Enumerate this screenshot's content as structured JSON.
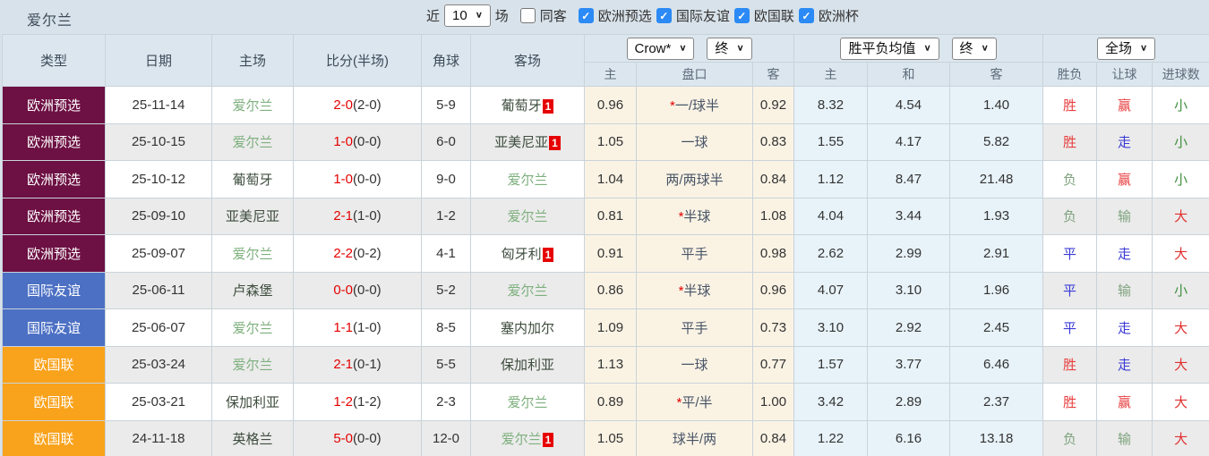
{
  "title": "爱尔兰",
  "icons": {
    "check": "✓",
    "chevron_down": "∨"
  },
  "toolbar": {
    "recent_label": "近",
    "recent_value": "10",
    "matches_label": "场",
    "same_away_label": "同客",
    "same_away_checked": false,
    "filters": [
      {
        "label": "欧洲预选",
        "checked": true
      },
      {
        "label": "国际友谊",
        "checked": true
      },
      {
        "label": "欧国联",
        "checked": true
      },
      {
        "label": "欧洲杯",
        "checked": true
      }
    ]
  },
  "table": {
    "columns": [
      "类型",
      "日期",
      "主场",
      "比分(半场)",
      "角球",
      "客场"
    ],
    "handicap_group": {
      "bookmaker_select": "Crow*",
      "time_select": "终",
      "subcols": [
        "主",
        "盘口",
        "客"
      ]
    },
    "odds_group": {
      "type_select": "胜平负均值",
      "time_select": "终",
      "subcols": [
        "主",
        "和",
        "客"
      ]
    },
    "result_group": {
      "scope_select": "全场",
      "subcols": [
        "胜负",
        "让球",
        "进球数"
      ]
    },
    "focus_team": "爱尔兰",
    "type_colors": {
      "欧洲预选": "#6D1043",
      "国际友谊": "#4C70C4",
      "欧国联": "#F9A21B"
    },
    "result_colors": {
      "胜": "#e83e3e",
      "平": "#3a3ad8",
      "负": "#7fa37f",
      "赢": "#e83e3e",
      "走": "#3a3ad8",
      "输": "#7fa37f",
      "大": "#e03030",
      "小": "#3f8f3f"
    },
    "rows": [
      {
        "type": "欧洲预选",
        "date": "25-11-14",
        "home": "爱尔兰",
        "score": "2-0",
        "half": "(2-0)",
        "corners": "5-9",
        "away": "葡萄牙",
        "away_badge": "1",
        "ah_home": "0.96",
        "handicap": "*一/球半",
        "ah_away": "0.92",
        "avg_home": "8.32",
        "avg_draw": "4.54",
        "avg_away": "1.40",
        "wdl": "胜",
        "ah_result": "赢",
        "goals": "小"
      },
      {
        "type": "欧洲预选",
        "date": "25-10-15",
        "home": "爱尔兰",
        "score": "1-0",
        "half": "(0-0)",
        "corners": "6-0",
        "away": "亚美尼亚",
        "away_badge": "1",
        "ah_home": "1.05",
        "handicap": "一球",
        "ah_away": "0.83",
        "avg_home": "1.55",
        "avg_draw": "4.17",
        "avg_away": "5.82",
        "wdl": "胜",
        "ah_result": "走",
        "goals": "小"
      },
      {
        "type": "欧洲预选",
        "date": "25-10-12",
        "home": "葡萄牙",
        "score": "1-0",
        "half": "(0-0)",
        "corners": "9-0",
        "away": "爱尔兰",
        "ah_home": "1.04",
        "handicap": "两/两球半",
        "ah_away": "0.84",
        "avg_home": "1.12",
        "avg_draw": "8.47",
        "avg_away": "21.48",
        "wdl": "负",
        "ah_result": "赢",
        "goals": "小"
      },
      {
        "type": "欧洲预选",
        "date": "25-09-10",
        "home": "亚美尼亚",
        "score": "2-1",
        "half": "(1-0)",
        "corners": "1-2",
        "away": "爱尔兰",
        "ah_home": "0.81",
        "handicap": "*半球",
        "ah_away": "1.08",
        "avg_home": "4.04",
        "avg_draw": "3.44",
        "avg_away": "1.93",
        "wdl": "负",
        "ah_result": "输",
        "goals": "大"
      },
      {
        "type": "欧洲预选",
        "date": "25-09-07",
        "home": "爱尔兰",
        "score": "2-2",
        "half": "(0-2)",
        "corners": "4-1",
        "away": "匈牙利",
        "away_badge": "1",
        "ah_home": "0.91",
        "handicap": "平手",
        "ah_away": "0.98",
        "avg_home": "2.62",
        "avg_draw": "2.99",
        "avg_away": "2.91",
        "wdl": "平",
        "ah_result": "走",
        "goals": "大"
      },
      {
        "type": "国际友谊",
        "date": "25-06-11",
        "home": "卢森堡",
        "score": "0-0",
        "half": "(0-0)",
        "corners": "5-2",
        "away": "爱尔兰",
        "ah_home": "0.86",
        "handicap": "*半球",
        "ah_away": "0.96",
        "avg_home": "4.07",
        "avg_draw": "3.10",
        "avg_away": "1.96",
        "wdl": "平",
        "ah_result": "输",
        "goals": "小"
      },
      {
        "type": "国际友谊",
        "date": "25-06-07",
        "home": "爱尔兰",
        "score": "1-1",
        "half": "(1-0)",
        "corners": "8-5",
        "away": "塞内加尔",
        "ah_home": "1.09",
        "handicap": "平手",
        "ah_away": "0.73",
        "avg_home": "3.10",
        "avg_draw": "2.92",
        "avg_away": "2.45",
        "wdl": "平",
        "ah_result": "走",
        "goals": "大"
      },
      {
        "type": "欧国联",
        "date": "25-03-24",
        "home": "爱尔兰",
        "score": "2-1",
        "half": "(0-1)",
        "corners": "5-5",
        "away": "保加利亚",
        "ah_home": "1.13",
        "handicap": "一球",
        "ah_away": "0.77",
        "avg_home": "1.57",
        "avg_draw": "3.77",
        "avg_away": "6.46",
        "wdl": "胜",
        "ah_result": "走",
        "goals": "大"
      },
      {
        "type": "欧国联",
        "date": "25-03-21",
        "home": "保加利亚",
        "score": "1-2",
        "half": "(1-2)",
        "corners": "2-3",
        "away": "爱尔兰",
        "ah_home": "0.89",
        "handicap": "*平/半",
        "ah_away": "1.00",
        "avg_home": "3.42",
        "avg_draw": "2.89",
        "avg_away": "2.37",
        "wdl": "胜",
        "ah_result": "赢",
        "goals": "大"
      },
      {
        "type": "欧国联",
        "date": "24-11-18",
        "home": "英格兰",
        "score": "5-0",
        "half": "(0-0)",
        "corners": "12-0",
        "away": "爱尔兰",
        "away_badge": "1",
        "ah_home": "1.05",
        "handicap": "球半/两",
        "ah_away": "0.84",
        "avg_home": "1.22",
        "avg_draw": "6.16",
        "avg_away": "13.18",
        "wdl": "负",
        "ah_result": "输",
        "goals": "大"
      }
    ]
  }
}
